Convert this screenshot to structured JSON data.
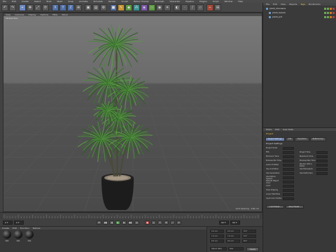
{
  "menubar": [
    "File",
    "Edit",
    "Create",
    "Select",
    "Tools",
    "Mesh",
    "Snap",
    "Animate",
    "Simulate",
    "Render",
    "Sculpt",
    "Motion Tracker",
    "MoGraph",
    "Character",
    "Pipeline",
    "Plugins",
    "Script",
    "Window",
    "Help"
  ],
  "viewport": {
    "menu": [
      "View",
      "Cameras",
      "Display",
      "Options",
      "Filter",
      "Panel"
    ],
    "label": "Perspective",
    "status": "Grid Spacing : 100 cm"
  },
  "timeline": {
    "frame_current": "0 F",
    "frame_start": "0 F",
    "frame_end": "90 F",
    "frame_total": "90 F"
  },
  "materials": {
    "menu": [
      "Create",
      "Edit",
      "Function",
      "Texture"
    ],
    "items": [
      "Mat",
      "Mat",
      "Mat"
    ]
  },
  "coords": {
    "rows": [
      {
        "a": "X 0 cm",
        "b": "X 0 cm",
        "c": "H 0°"
      },
      {
        "a": "Y 0 cm",
        "b": "Y 0 cm",
        "c": "P 0°"
      },
      {
        "a": "Z 0 cm",
        "b": "Z 0 cm",
        "c": "B 0°"
      }
    ],
    "mode1": "Object (Rel)",
    "mode2": "Size",
    "apply": "Apply"
  },
  "objects": {
    "tabs": [
      "File",
      "Edit",
      "View",
      "Objects",
      "Tags",
      "Bookmarks"
    ],
    "rows": [
      "plant_dracaena",
      "plant_leaves",
      "plant_pot"
    ]
  },
  "attributes": {
    "menu": [
      "Mode",
      "Edit",
      "User Data"
    ],
    "title": "Project",
    "tabs": [
      "Project Settings",
      "Info",
      "Dynamics",
      "Referencing"
    ],
    "section": "Project Settings",
    "rows": [
      {
        "l": "Project Scale",
        "r": ""
      },
      {
        "l": "FPS",
        "r": "Project Time"
      },
      {
        "l": "Minimum Time",
        "r": "Maximum Time"
      },
      {
        "l": "Preview Min Time",
        "r": "Preview Max Time"
      },
      {
        "l": "Level of Detail",
        "r": "Render LOD in Editor"
      },
      {
        "l": "Use Animation",
        "r": "Use Expression"
      },
      {
        "l": "Use Generators",
        "r": "Use Deformers"
      },
      {
        "l": "Use Motion System",
        "r": ""
      },
      {
        "l": "Default Object Color",
        "r": ""
      },
      {
        "l": "Color",
        "r": ""
      },
      {
        "l": "View Clipping",
        "r": ""
      },
      {
        "l": "Linear Workflow",
        "r": ""
      },
      {
        "l": "Input Color Profile",
        "r": ""
      }
    ],
    "buttons": [
      "Load Preset...",
      "Save Preset..."
    ]
  }
}
